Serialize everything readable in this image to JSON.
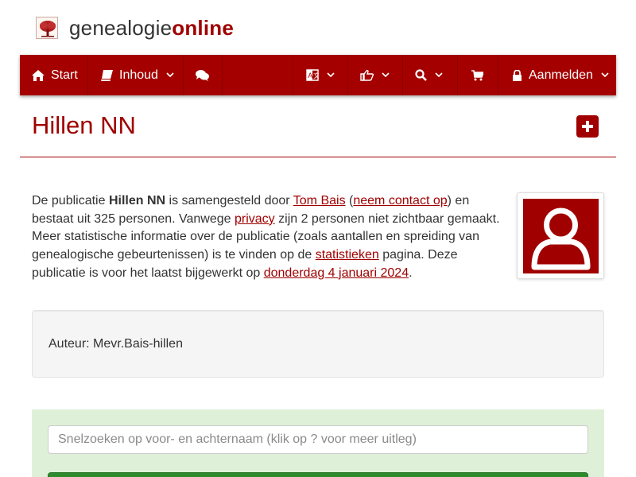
{
  "logo": {
    "text_plain": "genealogie",
    "text_bold": "online"
  },
  "nav": {
    "start_label": "Start",
    "inhoud_label": "Inhoud",
    "login_label": "Aanmelden"
  },
  "page": {
    "title": "Hillen NN"
  },
  "intro": {
    "t1": "De publicatie ",
    "pub_name": "Hillen NN",
    "t2": " is samengesteld door ",
    "author_link": "Tom Bais",
    "t3": " (",
    "contact_link": "neem contact op",
    "t4": ") en bestaat uit 325 personen. Vanwege ",
    "privacy_link": "privacy",
    "t5": " zijn 2 personen niet zichtbaar gemaakt. Meer statistische informatie over de publicatie (zoals aantallen en spreiding van genealogische gebeurtenissen) is te vinden op de ",
    "stats_link": "statistieken",
    "t6": " pagina. Deze publicatie is voor het laatst bijgewerkt op ",
    "date_link": "donderdag 4 januari 2024",
    "t7": "."
  },
  "author_box": {
    "text": "Auteur: Mevr.Bais-hillen"
  },
  "search": {
    "placeholder": "Snelzoeken op voor- en achternaam (klik op ? voor meer uitleg)"
  },
  "colors": {
    "brand": "#a40000",
    "search_bg": "#dff0d8",
    "search_button": "#2d8a2d"
  }
}
